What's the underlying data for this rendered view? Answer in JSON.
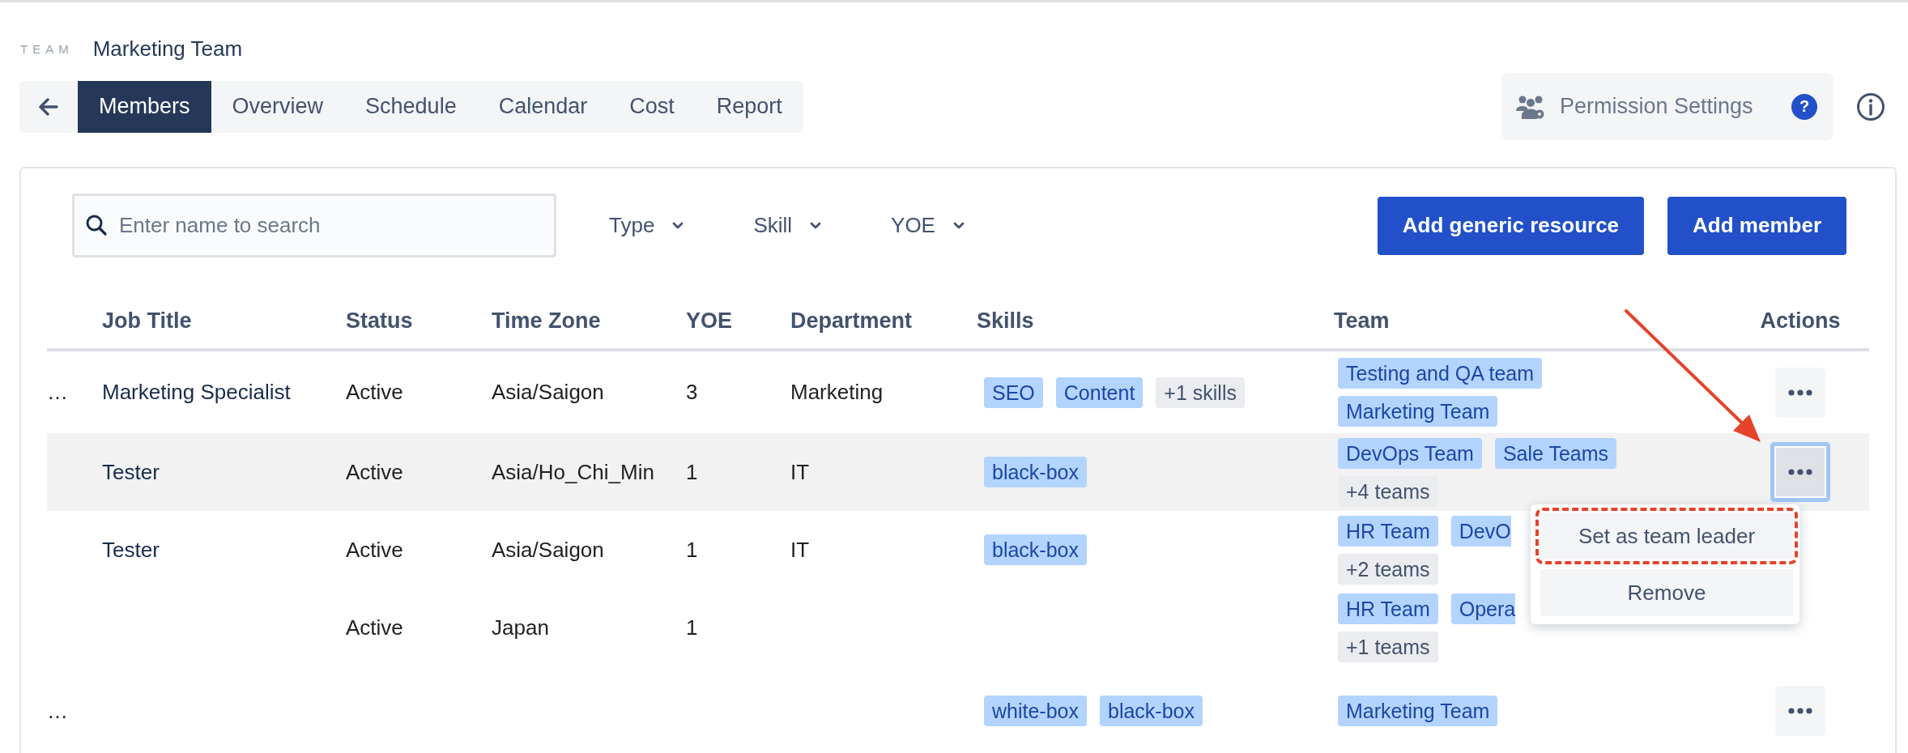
{
  "team": {
    "label": "TEAM",
    "name": "Marketing Team"
  },
  "nav": {
    "tabs": [
      {
        "label": "Members",
        "selected": true
      },
      {
        "label": "Overview",
        "selected": false
      },
      {
        "label": "Schedule",
        "selected": false
      },
      {
        "label": "Calendar",
        "selected": false
      },
      {
        "label": "Cost",
        "selected": false
      },
      {
        "label": "Report",
        "selected": false
      }
    ]
  },
  "permission_button": {
    "label": "Permission Settings",
    "help": "?"
  },
  "search": {
    "placeholder": "Enter name to search"
  },
  "filters": [
    {
      "label": "Type"
    },
    {
      "label": "Skill"
    },
    {
      "label": "YOE"
    }
  ],
  "buttons": [
    "Add generic resource",
    "Add member"
  ],
  "table": {
    "columns": [
      "Job Title",
      "Status",
      "Time Zone",
      "YOE",
      "Department",
      "Skills",
      "Team",
      "Actions"
    ],
    "rows": [
      {
        "column_1": "…",
        "job_title": "Marketing Specialist",
        "status": "Active",
        "time_zone": "Asia/Saigon",
        "yoe": "3",
        "department": "Marketing",
        "highlighted": false,
        "skills": [
          {
            "label": "SEO",
            "kind": "tag"
          },
          {
            "label": "Content",
            "kind": "tag"
          },
          {
            "label": "+1 skills",
            "kind": "more"
          }
        ],
        "team_lines": [
          [
            {
              "label": "Testing and QA team",
              "kind": "tag"
            }
          ],
          [
            {
              "label": "Marketing Team",
              "kind": "tag"
            }
          ]
        ],
        "action": {
          "focused": false
        }
      },
      {
        "job_title": "Tester",
        "status": "Active",
        "time_zone": "Asia/Ho_Chi_Min",
        "yoe": "1",
        "department": "IT",
        "highlighted": true,
        "skills": [
          {
            "label": "black-box",
            "kind": "tag"
          }
        ],
        "team_lines": [
          [
            {
              "label": "DevOps Team",
              "kind": "tag"
            },
            {
              "label": "Sale Teams",
              "kind": "tag"
            }
          ],
          [
            {
              "label": "+4 teams",
              "kind": "more"
            }
          ]
        ],
        "action": {
          "focused": true
        }
      },
      {
        "job_title": "Tester",
        "status": "Active",
        "time_zone": "Asia/Saigon",
        "yoe": "1",
        "department": "IT",
        "highlighted": false,
        "skills": [
          {
            "label": "black-box",
            "kind": "tag"
          }
        ],
        "team_lines": [
          [
            {
              "label": "HR Team",
              "kind": "tag"
            },
            {
              "label": "DevO",
              "kind": "cut"
            }
          ],
          [
            {
              "label": "+2 teams",
              "kind": "more"
            }
          ]
        ]
      },
      {
        "status": "Active",
        "time_zone": "Japan",
        "yoe": "1",
        "highlighted": false,
        "team_lines": [
          [
            {
              "label": "HR Team",
              "kind": "tag"
            },
            {
              "label": "Opera",
              "kind": "cut"
            }
          ],
          [
            {
              "label": "+1 teams",
              "kind": "more"
            }
          ]
        ]
      },
      {
        "column_1": "…",
        "highlighted": false,
        "skills": [
          {
            "label": "white-box",
            "kind": "tag"
          },
          {
            "label": "black-box",
            "kind": "tag"
          }
        ],
        "team_lines": [
          [
            {
              "label": "Marketing Team",
              "kind": "tag"
            }
          ]
        ],
        "action": {
          "focused": false
        }
      }
    ]
  },
  "menu": {
    "items": [
      {
        "label": "Set as team leader",
        "outlined": true
      },
      {
        "label": "Remove",
        "outlined": false
      }
    ]
  }
}
